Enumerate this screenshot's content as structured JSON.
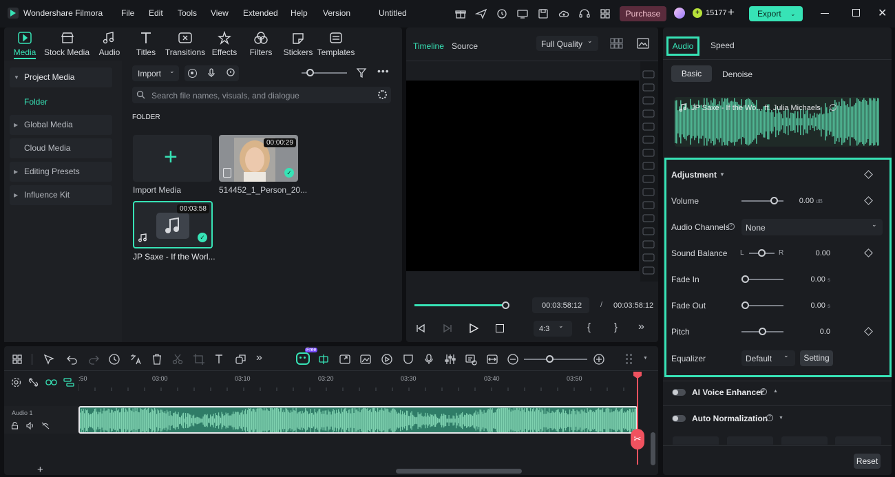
{
  "app": {
    "title": "Wondershare Filmora",
    "project_title": "Untitled",
    "menu": [
      "File",
      "Edit",
      "Tools",
      "View",
      "Extended",
      "Help",
      "Version"
    ],
    "purchase_label": "Purchase",
    "credits": "15177",
    "export_label": "Export"
  },
  "media_tabs": [
    {
      "label": "Media",
      "active": true
    },
    {
      "label": "Stock Media"
    },
    {
      "label": "Audio"
    },
    {
      "label": "Titles"
    },
    {
      "label": "Transitions"
    },
    {
      "label": "Effects"
    },
    {
      "label": "Filters"
    },
    {
      "label": "Stickers"
    },
    {
      "label": "Templates"
    }
  ],
  "sidebar": {
    "project_media": "Project Media",
    "folder": "Folder",
    "global_media": "Global Media",
    "cloud_media": "Cloud Media",
    "editing_presets": "Editing Presets",
    "influence_kit": "Influence Kit"
  },
  "media_toolbar": {
    "import_label": "Import",
    "search_placeholder": "Search file names, visuals, and dialogue"
  },
  "media_grid": {
    "folder_label": "FOLDER",
    "items": [
      {
        "label": "Import Media"
      },
      {
        "label": "514452_1_Person_20...",
        "duration": "00:00:29"
      },
      {
        "label": "JP Saxe - If the Worl...",
        "duration": "00:03:58"
      }
    ]
  },
  "preview": {
    "tab_timeline": "Timeline",
    "tab_source": "Source",
    "quality": "Full Quality",
    "current_time": "00:03:58:12",
    "separator": "/",
    "total_time": "00:03:58:12",
    "aspect": "4:3",
    "progress": 1.0
  },
  "properties": {
    "tab_audio": "Audio",
    "tab_speed": "Speed",
    "subtab_basic": "Basic",
    "subtab_denoise": "Denoise",
    "clip_name": "JP Saxe - If the Wo... ft. Julia Michaels",
    "adjustment": "Adjustment",
    "volume_label": "Volume",
    "volume_value": "0.00",
    "volume_unit": "dB",
    "channels_label": "Audio Channels",
    "channels_value": "None",
    "balance_label": "Sound Balance",
    "balance_l": "L",
    "balance_r": "R",
    "balance_value": "0.00",
    "fadein_label": "Fade In",
    "fadein_value": "0.00",
    "fadeout_label": "Fade Out",
    "fadeout_value": "0.00",
    "fade_unit": "s",
    "pitch_label": "Pitch",
    "pitch_value": "0.0",
    "eq_label": "Equalizer",
    "eq_value": "Default",
    "eq_setting": "Setting",
    "voice_enhancer": "AI Voice Enhancer",
    "auto_norm": "Auto Normalization",
    "reset": "Reset"
  },
  "timeline": {
    "ruler": [
      ":50",
      "03:00",
      "03:10",
      "03:20",
      "03:30",
      "03:40",
      "03:50"
    ],
    "track_label": "Audio 1",
    "free_badge": "Free"
  },
  "colors": {
    "accent": "#37e3b6",
    "waveform": "#4fb592",
    "playhead": "#f0525f",
    "purchase_bg": "#5a2b3c"
  }
}
